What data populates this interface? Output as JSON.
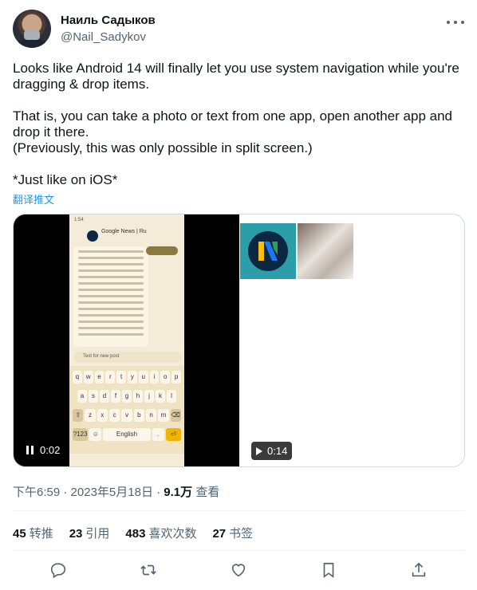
{
  "author": {
    "name": "Наиль Садыков",
    "handle": "@Nail_Sadykov"
  },
  "tweet": {
    "paragraphs": [
      "Looks like Android 14 will finally let you use system navigation while you're dragging & drop items.",
      "That is, you can take a photo or text from one app, open another app and drop it there.",
      "(Previously, this was only possible in split screen.)",
      "*Just like on iOS*"
    ],
    "translate_label": "翻译推文"
  },
  "media": {
    "video1": {
      "time": "0:02",
      "phone": {
        "status": "1:54",
        "app_title": "Google News | Ru",
        "input_text": "Text for new post",
        "keyboard_rows": [
          [
            "q",
            "w",
            "e",
            "r",
            "t",
            "y",
            "u",
            "i",
            "o",
            "p"
          ],
          [
            "a",
            "s",
            "d",
            "f",
            "g",
            "h",
            "j",
            "k",
            "l"
          ],
          [
            "⇧",
            "z",
            "x",
            "c",
            "v",
            "b",
            "n",
            "m",
            "⌫"
          ],
          [
            "?123",
            "☺",
            "English",
            ".",
            "⏎"
          ]
        ]
      }
    },
    "video2": {
      "time": "0:14"
    }
  },
  "meta": {
    "time": "下午6:59",
    "date": "2023年5月18日",
    "views_count": "9.1万",
    "views_label": "查看"
  },
  "stats": [
    {
      "count": "45",
      "label": "转推"
    },
    {
      "count": "23",
      "label": "引用"
    },
    {
      "count": "483",
      "label": "喜欢次数"
    },
    {
      "count": "27",
      "label": "书签"
    }
  ],
  "actions": [
    "reply-icon",
    "retweet-icon",
    "like-icon",
    "bookmark-icon",
    "share-icon"
  ],
  "colors": {
    "link": "#1d9bf0",
    "secondary": "#536471",
    "text": "#0f1419"
  }
}
